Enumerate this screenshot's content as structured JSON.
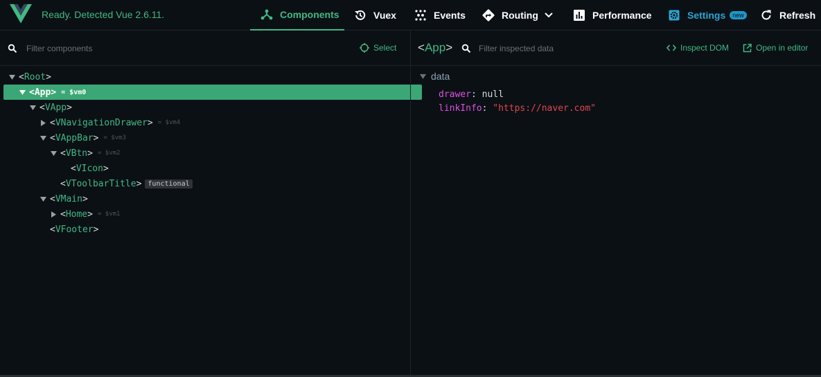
{
  "header": {
    "status": "Ready. Detected Vue 2.6.11.",
    "tabs": {
      "components": "Components",
      "vuex": "Vuex",
      "events": "Events",
      "routing": "Routing",
      "performance": "Performance",
      "settings": "Settings",
      "settings_badge": "new",
      "refresh": "Refresh"
    }
  },
  "left": {
    "filter_placeholder": "Filter components",
    "select_label": "Select",
    "tree": [
      {
        "name": "Root",
        "vm": ""
      },
      {
        "name": "App",
        "vm": "= $vm0"
      },
      {
        "name": "VApp",
        "vm": ""
      },
      {
        "name": "VNavigationDrawer",
        "vm": "= $vm4"
      },
      {
        "name": "VAppBar",
        "vm": "= $vm3"
      },
      {
        "name": "VBtn",
        "vm": "= $vm2"
      },
      {
        "name": "VIcon",
        "vm": ""
      },
      {
        "name": "VToolbarTitle",
        "vm": "",
        "tag": "functional"
      },
      {
        "name": "VMain",
        "vm": ""
      },
      {
        "name": "Home",
        "vm": "= $vm1"
      },
      {
        "name": "VFooter",
        "vm": ""
      }
    ]
  },
  "right": {
    "selected_component": "App",
    "filter_placeholder": "Filter inspected data",
    "inspect_dom_label": "Inspect DOM",
    "open_editor_label": "Open in editor",
    "section_label": "data",
    "props": [
      {
        "key": "drawer",
        "value": "null"
      },
      {
        "key": "linkInfo",
        "value": "\"https://naver.com\""
      }
    ]
  },
  "colors": {
    "accent": "#42b883",
    "selected_row": "#3ba776",
    "settings": "#2ba5d3",
    "background": "#0b1015"
  }
}
